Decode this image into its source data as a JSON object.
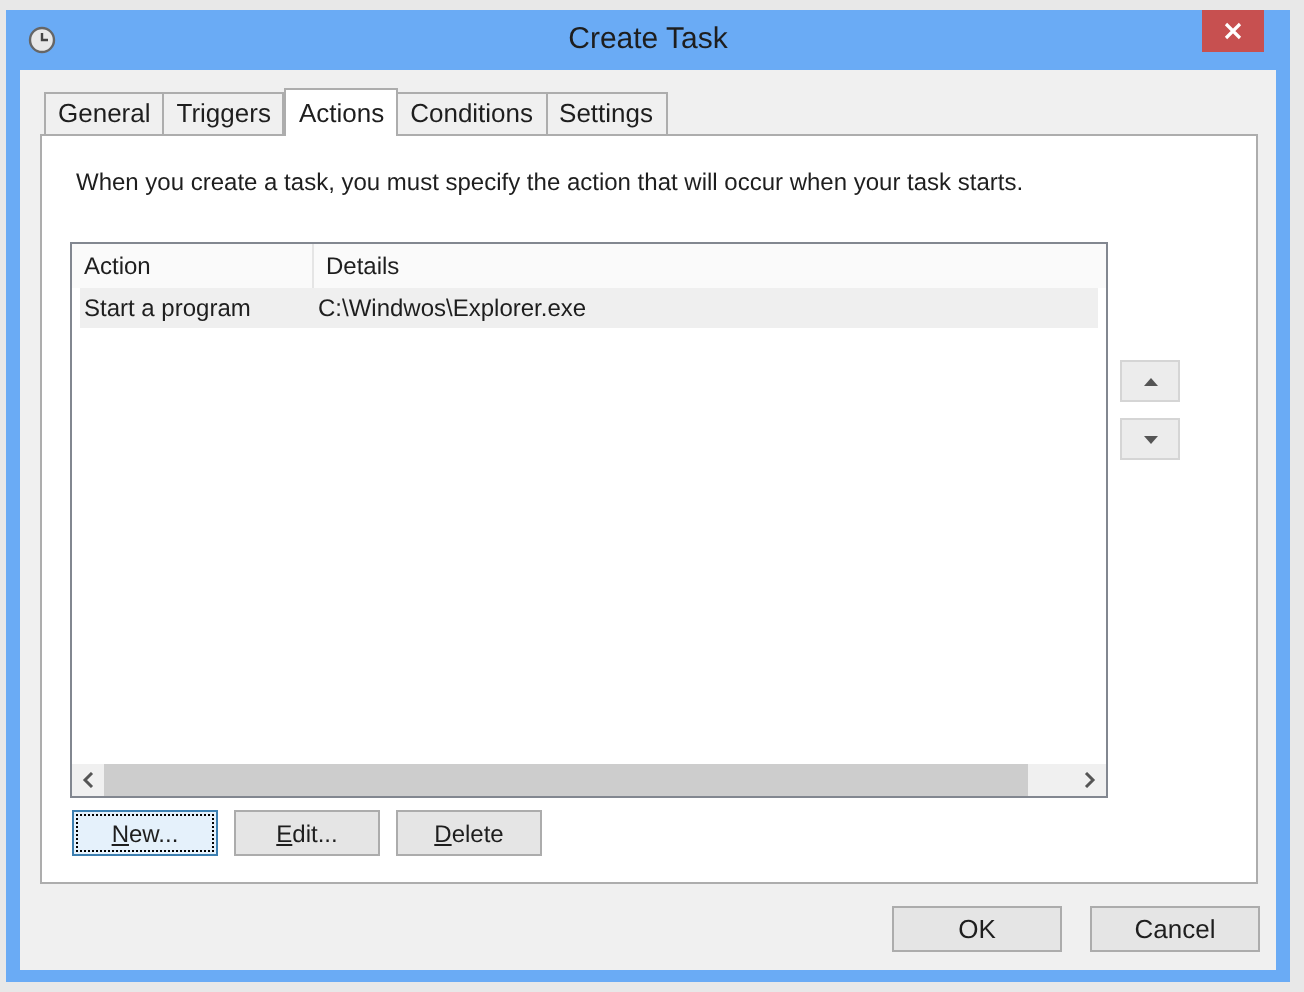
{
  "window": {
    "title": "Create Task"
  },
  "tabs": [
    {
      "label": "General",
      "selected": false
    },
    {
      "label": "Triggers",
      "selected": false
    },
    {
      "label": "Actions",
      "selected": true
    },
    {
      "label": "Conditions",
      "selected": false
    },
    {
      "label": "Settings",
      "selected": false
    }
  ],
  "description": "When you create a task, you must specify the action that will occur when your task starts.",
  "table": {
    "columns": [
      "Action",
      "Details"
    ],
    "rows": [
      {
        "cells": [
          "Start a program",
          "C:\\Windwos\\Explorer.exe"
        ],
        "selected": true
      }
    ]
  },
  "action_buttons": [
    {
      "label": "New...",
      "focused": true
    },
    {
      "label": "Edit...",
      "focused": false
    },
    {
      "label": "Delete",
      "focused": false
    }
  ],
  "dialog_buttons": [
    "OK",
    "Cancel"
  ]
}
